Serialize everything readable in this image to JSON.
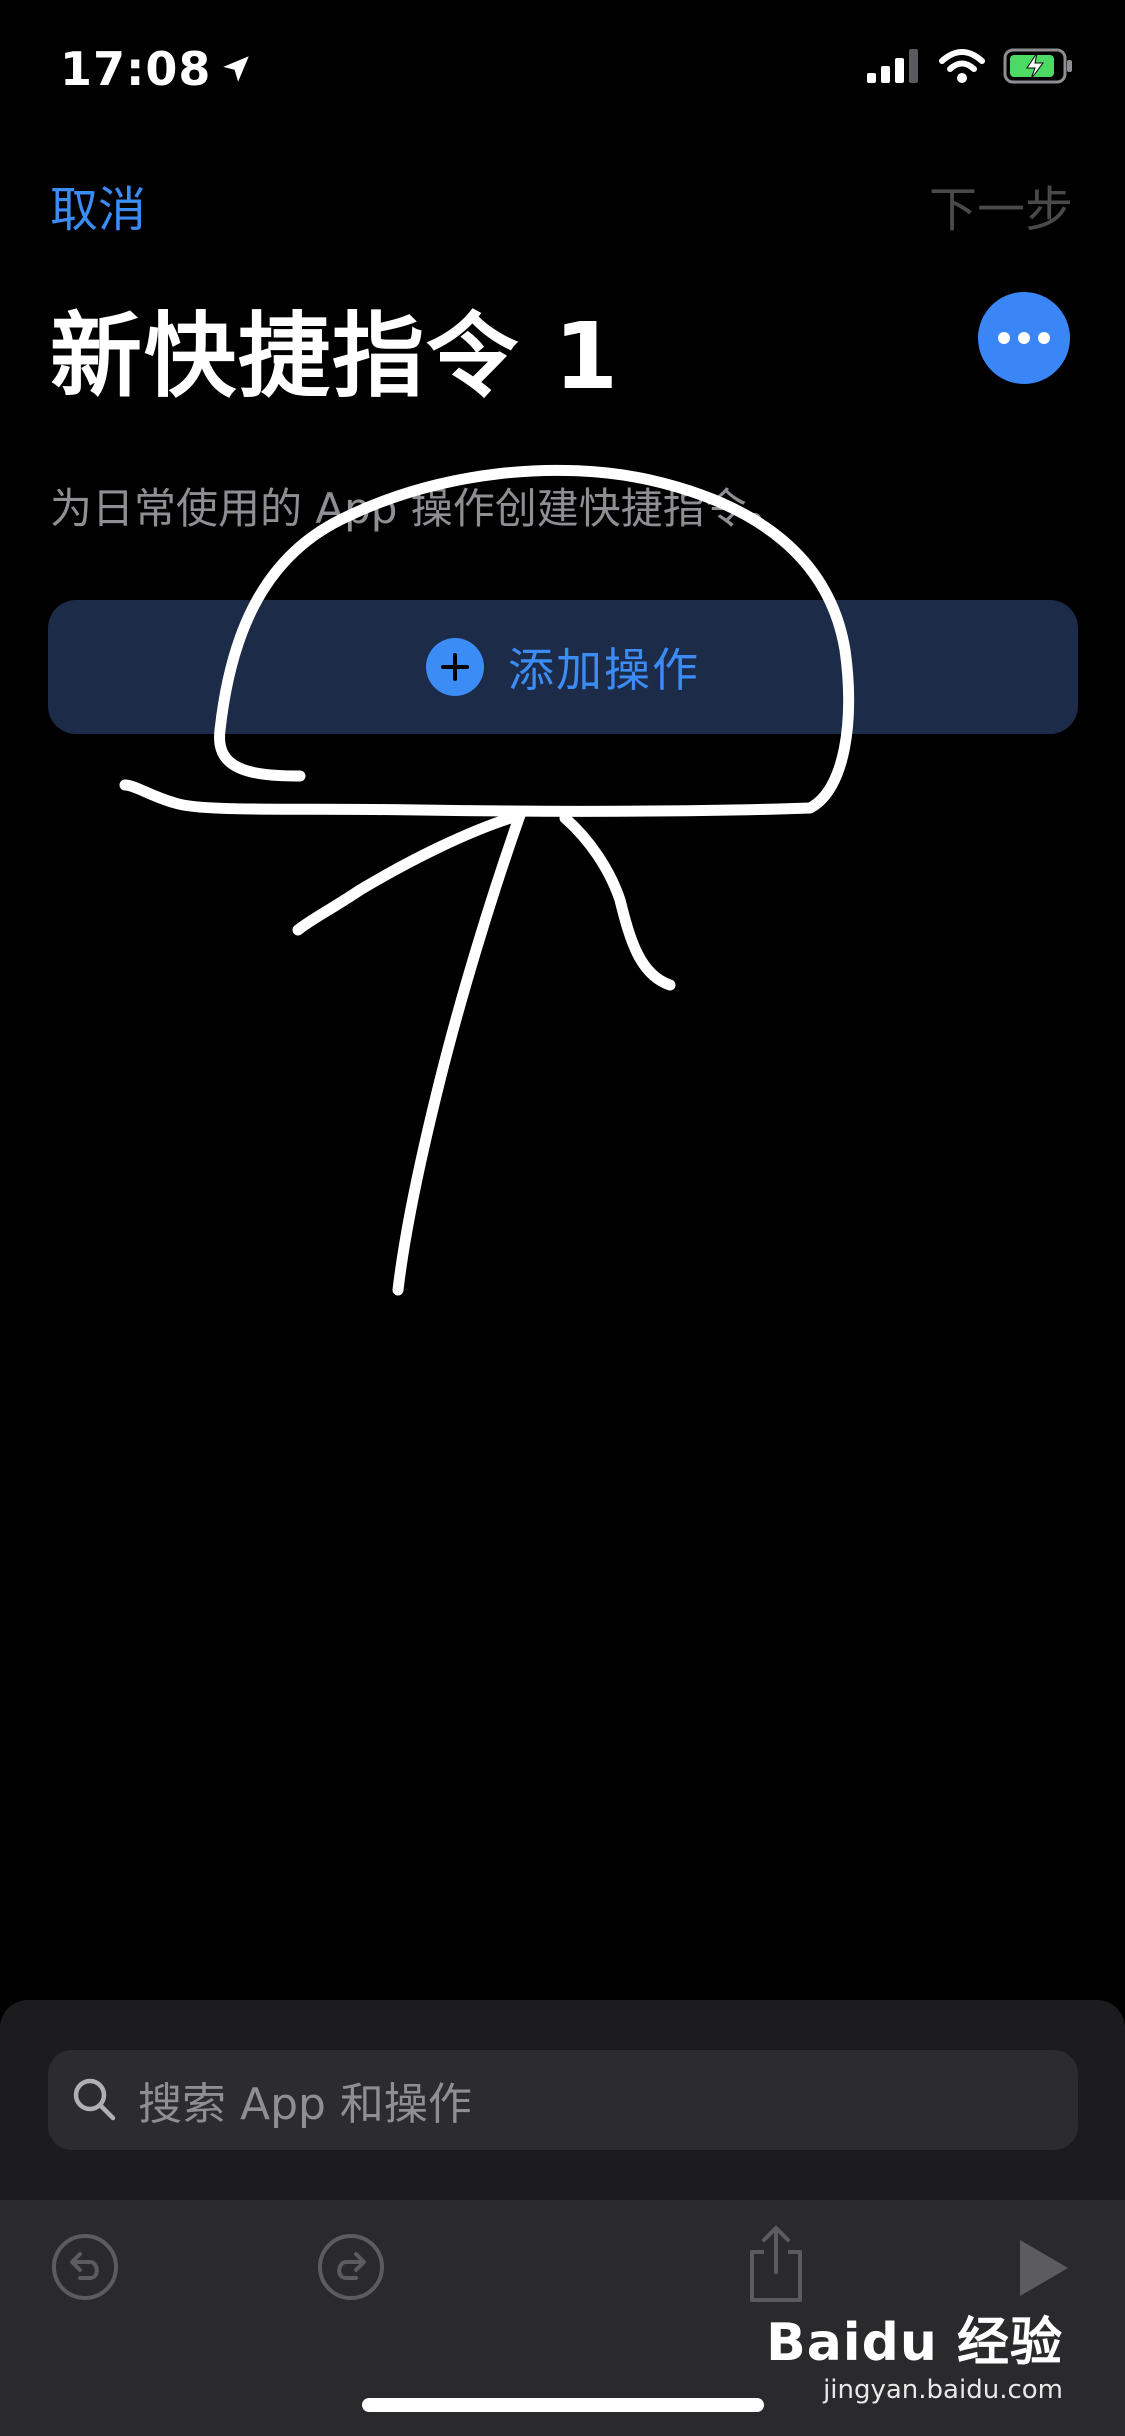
{
  "status": {
    "time": "17:08"
  },
  "nav": {
    "cancel_label": "取消",
    "next_label": "下一步"
  },
  "title": "新快捷指令 1",
  "subtitle": "为日常使用的 App 操作创建快捷指令。",
  "add_action": {
    "label": "添加操作"
  },
  "search": {
    "placeholder": "搜索 App 和操作"
  },
  "toolbar": {
    "icons": [
      "undo-icon",
      "redo-icon",
      "share-icon",
      "play-icon"
    ]
  },
  "watermark": {
    "logo": "Bai du 经验",
    "site": "jingyan.baidu.com"
  },
  "colors": {
    "accent": "#3b8cf5",
    "card": "#1c2b48",
    "background": "#000000"
  }
}
